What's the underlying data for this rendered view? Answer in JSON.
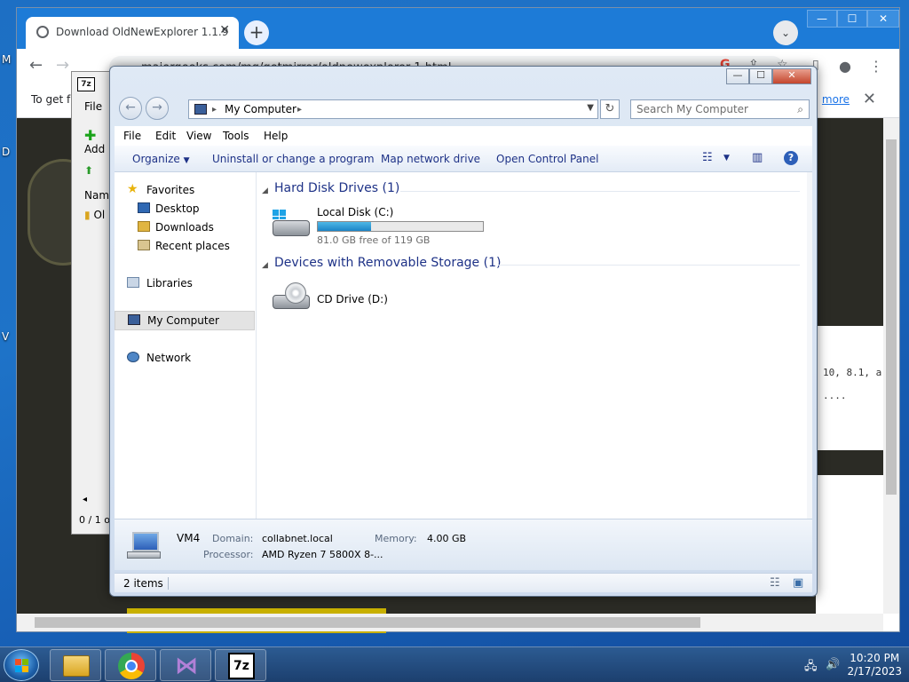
{
  "desktop": {
    "side_letters": [
      "M",
      "D",
      "V"
    ]
  },
  "chrome": {
    "tab_title": "Download OldNewExplorer 1.1.9",
    "tab_close": "✕",
    "new_tab": "+",
    "url": "majorgeeks.com/mg/getmirror/oldnewexplorer,1.html",
    "infobar_text": "To get f",
    "infobar_link": "more",
    "infobar_close": "✕",
    "page_text_1": "10, 8.1, a",
    "page_text_2": "....",
    "win_min": "—",
    "win_max": "☐",
    "win_close": "✕"
  },
  "zip": {
    "logo": "7z",
    "menu_file": "File",
    "add_label": "Add",
    "col_name": "Nam",
    "item_name": "Ol",
    "status": "0 / 1 o"
  },
  "explorer": {
    "title_min": "—",
    "title_max": "☐",
    "title_close": "✕",
    "address": "My Computer",
    "search_placeholder": "Search My Computer",
    "menu": [
      "File",
      "Edit",
      "View",
      "Tools",
      "Help"
    ],
    "commands": {
      "organize": "Organize",
      "uninstall": "Uninstall or change a program",
      "map_drive": "Map network drive",
      "control_panel": "Open Control Panel"
    },
    "nav": {
      "favorites": "Favorites",
      "desktop": "Desktop",
      "downloads": "Downloads",
      "recent": "Recent places",
      "libraries": "Libraries",
      "my_computer": "My Computer",
      "network": "Network"
    },
    "groups": {
      "hdd": "Hard Disk Drives (1)",
      "removable": "Devices with Removable Storage (1)"
    },
    "drives": {
      "c_name": "Local Disk (C:)",
      "c_free": "81.0 GB free of 119 GB",
      "c_used_fraction": 0.32,
      "d_name": "CD Drive (D:)"
    },
    "details": {
      "computer_name": "VM4",
      "domain_label": "Domain:",
      "domain_value": "collabnet.local",
      "memory_label": "Memory:",
      "memory_value": "4.00 GB",
      "processor_label": "Processor:",
      "processor_value": "AMD Ryzen 7 5800X 8-..."
    },
    "status": "2 items"
  },
  "taskbar": {
    "time": "10:20 PM",
    "date": "2/17/2023",
    "zip_label": "7z"
  },
  "colors": {
    "accent": "#1e3287",
    "chrome_blue": "#1d7bd7",
    "desktop_blue": "#1e73c8"
  }
}
